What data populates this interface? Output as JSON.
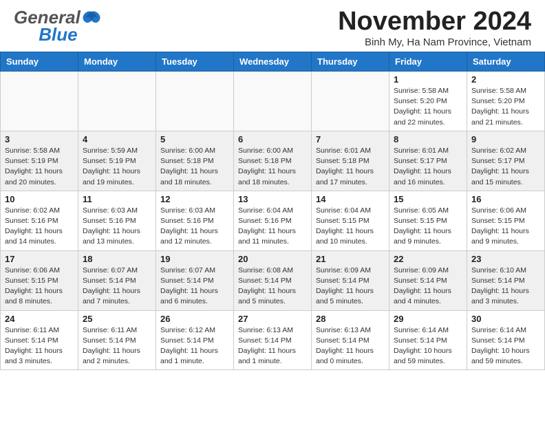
{
  "header": {
    "logo_general": "General",
    "logo_blue": "Blue",
    "month_title": "November 2024",
    "location": "Binh My, Ha Nam Province, Vietnam"
  },
  "days_of_week": [
    "Sunday",
    "Monday",
    "Tuesday",
    "Wednesday",
    "Thursday",
    "Friday",
    "Saturday"
  ],
  "weeks": [
    [
      {
        "day": "",
        "info": "",
        "empty": true
      },
      {
        "day": "",
        "info": "",
        "empty": true
      },
      {
        "day": "",
        "info": "",
        "empty": true
      },
      {
        "day": "",
        "info": "",
        "empty": true
      },
      {
        "day": "",
        "info": "",
        "empty": true
      },
      {
        "day": "1",
        "info": "Sunrise: 5:58 AM\nSunset: 5:20 PM\nDaylight: 11 hours\nand 22 minutes."
      },
      {
        "day": "2",
        "info": "Sunrise: 5:58 AM\nSunset: 5:20 PM\nDaylight: 11 hours\nand 21 minutes."
      }
    ],
    [
      {
        "day": "3",
        "info": "Sunrise: 5:58 AM\nSunset: 5:19 PM\nDaylight: 11 hours\nand 20 minutes."
      },
      {
        "day": "4",
        "info": "Sunrise: 5:59 AM\nSunset: 5:19 PM\nDaylight: 11 hours\nand 19 minutes."
      },
      {
        "day": "5",
        "info": "Sunrise: 6:00 AM\nSunset: 5:18 PM\nDaylight: 11 hours\nand 18 minutes."
      },
      {
        "day": "6",
        "info": "Sunrise: 6:00 AM\nSunset: 5:18 PM\nDaylight: 11 hours\nand 18 minutes."
      },
      {
        "day": "7",
        "info": "Sunrise: 6:01 AM\nSunset: 5:18 PM\nDaylight: 11 hours\nand 17 minutes."
      },
      {
        "day": "8",
        "info": "Sunrise: 6:01 AM\nSunset: 5:17 PM\nDaylight: 11 hours\nand 16 minutes."
      },
      {
        "day": "9",
        "info": "Sunrise: 6:02 AM\nSunset: 5:17 PM\nDaylight: 11 hours\nand 15 minutes."
      }
    ],
    [
      {
        "day": "10",
        "info": "Sunrise: 6:02 AM\nSunset: 5:16 PM\nDaylight: 11 hours\nand 14 minutes."
      },
      {
        "day": "11",
        "info": "Sunrise: 6:03 AM\nSunset: 5:16 PM\nDaylight: 11 hours\nand 13 minutes."
      },
      {
        "day": "12",
        "info": "Sunrise: 6:03 AM\nSunset: 5:16 PM\nDaylight: 11 hours\nand 12 minutes."
      },
      {
        "day": "13",
        "info": "Sunrise: 6:04 AM\nSunset: 5:16 PM\nDaylight: 11 hours\nand 11 minutes."
      },
      {
        "day": "14",
        "info": "Sunrise: 6:04 AM\nSunset: 5:15 PM\nDaylight: 11 hours\nand 10 minutes."
      },
      {
        "day": "15",
        "info": "Sunrise: 6:05 AM\nSunset: 5:15 PM\nDaylight: 11 hours\nand 9 minutes."
      },
      {
        "day": "16",
        "info": "Sunrise: 6:06 AM\nSunset: 5:15 PM\nDaylight: 11 hours\nand 9 minutes."
      }
    ],
    [
      {
        "day": "17",
        "info": "Sunrise: 6:06 AM\nSunset: 5:15 PM\nDaylight: 11 hours\nand 8 minutes."
      },
      {
        "day": "18",
        "info": "Sunrise: 6:07 AM\nSunset: 5:14 PM\nDaylight: 11 hours\nand 7 minutes."
      },
      {
        "day": "19",
        "info": "Sunrise: 6:07 AM\nSunset: 5:14 PM\nDaylight: 11 hours\nand 6 minutes."
      },
      {
        "day": "20",
        "info": "Sunrise: 6:08 AM\nSunset: 5:14 PM\nDaylight: 11 hours\nand 5 minutes."
      },
      {
        "day": "21",
        "info": "Sunrise: 6:09 AM\nSunset: 5:14 PM\nDaylight: 11 hours\nand 5 minutes."
      },
      {
        "day": "22",
        "info": "Sunrise: 6:09 AM\nSunset: 5:14 PM\nDaylight: 11 hours\nand 4 minutes."
      },
      {
        "day": "23",
        "info": "Sunrise: 6:10 AM\nSunset: 5:14 PM\nDaylight: 11 hours\nand 3 minutes."
      }
    ],
    [
      {
        "day": "24",
        "info": "Sunrise: 6:11 AM\nSunset: 5:14 PM\nDaylight: 11 hours\nand 3 minutes."
      },
      {
        "day": "25",
        "info": "Sunrise: 6:11 AM\nSunset: 5:14 PM\nDaylight: 11 hours\nand 2 minutes."
      },
      {
        "day": "26",
        "info": "Sunrise: 6:12 AM\nSunset: 5:14 PM\nDaylight: 11 hours\nand 1 minute."
      },
      {
        "day": "27",
        "info": "Sunrise: 6:13 AM\nSunset: 5:14 PM\nDaylight: 11 hours\nand 1 minute."
      },
      {
        "day": "28",
        "info": "Sunrise: 6:13 AM\nSunset: 5:14 PM\nDaylight: 11 hours\nand 0 minutes."
      },
      {
        "day": "29",
        "info": "Sunrise: 6:14 AM\nSunset: 5:14 PM\nDaylight: 10 hours\nand 59 minutes."
      },
      {
        "day": "30",
        "info": "Sunrise: 6:14 AM\nSunset: 5:14 PM\nDaylight: 10 hours\nand 59 minutes."
      }
    ]
  ]
}
